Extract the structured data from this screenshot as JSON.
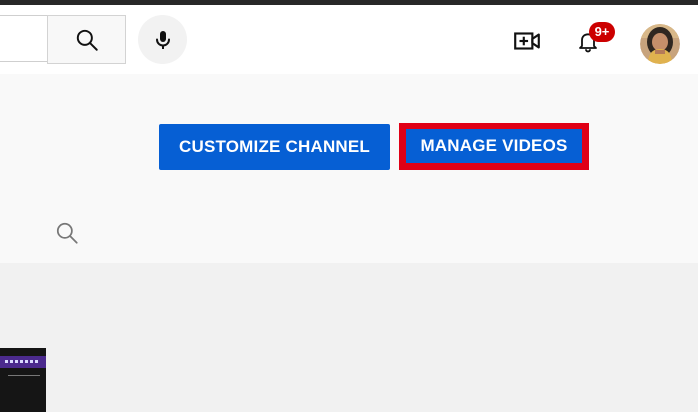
{
  "header": {
    "icons": {
      "search": "search-icon",
      "mic": "microphone-icon",
      "create": "video-create-icon",
      "notifications": "bell-icon"
    },
    "notification_count": "9+"
  },
  "channel": {
    "customize_label": "CUSTOMIZE CHANNEL",
    "manage_label": "MANAGE VIDEOS",
    "search_icon": "search-icon"
  },
  "colors": {
    "primary_button": "#065fd4",
    "highlight": "#e00016",
    "notification_badge": "#cc0000",
    "header_background": "#ffffff",
    "channel_background": "#f9f9f9",
    "content_background": "#f1f1f1"
  }
}
